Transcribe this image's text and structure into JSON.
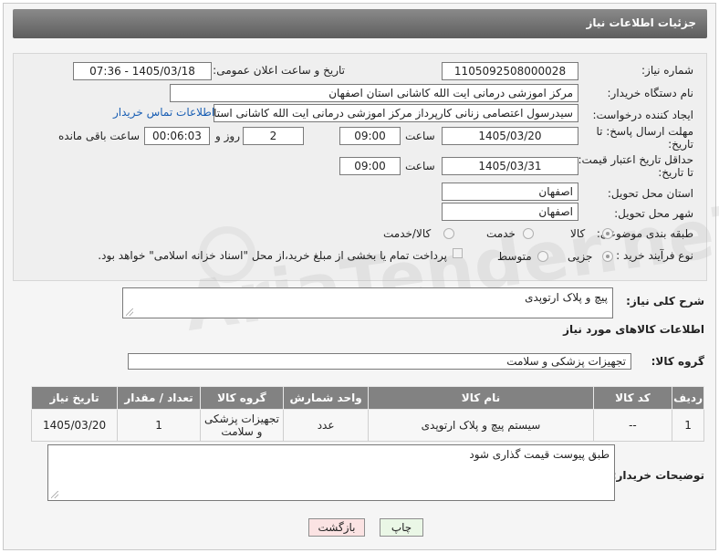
{
  "header": {
    "title": "جزئیات اطلاعات نیاز"
  },
  "fields": {
    "need_number_label": "شماره نیاز:",
    "need_number": "1105092508000028",
    "announce_label": "تاریخ و ساعت اعلان عمومی:",
    "announce_value": "1405/03/18 - 07:36",
    "buyer_org_label": "نام دستگاه خریدار:",
    "buyer_org": "مرکز اموزشی درمانی ایت الله کاشانی استان اصفهان",
    "requester_label": "ایجاد کننده درخواست:",
    "requester": "سیدرسول اعتصامی زنانی کارپرداز مرکز اموزشی درمانی ایت الله کاشانی استان اصفهان",
    "contact_link": "اطلاعات تماس خریدار",
    "deadline_label_1": "مهلت ارسال پاسخ: تا",
    "deadline_label_2": "تاریخ:",
    "deadline_date": "1405/03/20",
    "time_label": "ساعت",
    "deadline_time": "09:00",
    "days_value": "2",
    "days_label": "روز و",
    "remaining_value": "00:06:03",
    "remaining_label": "ساعت باقی مانده",
    "validity_label_1": "حداقل تاریخ اعتبار قیمت:",
    "validity_label_2": "تا تاریخ:",
    "validity_date": "1405/03/31",
    "validity_time": "09:00",
    "province_label": "استان محل تحویل:",
    "province": "اصفهان",
    "city_label": "شهر محل تحویل:",
    "city": "اصفهان",
    "category_label": "طبقه بندی موضوعی:",
    "category_options": [
      "کالا",
      "خدمت",
      "کالا/خدمت"
    ],
    "process_label": "نوع فرآیند خرید :",
    "process_options": [
      "جزیی",
      "متوسط"
    ],
    "payment_note": "پرداخت تمام یا بخشی از مبلغ خرید،از محل \"اسناد خزانه اسلامی\" خواهد بود."
  },
  "description": {
    "label": "شرح کلی نیاز:",
    "value": "پیچ و پلاک ارتوپدی"
  },
  "goods_section": {
    "title": "اطلاعات کالاهای مورد نیاز",
    "group_label": "گروه کالا:",
    "group_value": "تجهیزات پزشکی و سلامت"
  },
  "table": {
    "headers": [
      "ردیف",
      "کد کالا",
      "نام کالا",
      "واحد شمارش",
      "گروه کالا",
      "تعداد / مقدار",
      "تاریخ نیاز"
    ],
    "rows": [
      {
        "row": "1",
        "code": "--",
        "name": "سیستم پیچ و پلاک ارتوپدی",
        "unit": "عدد",
        "group": "تجهیزات پزشکی و سلامت",
        "qty": "1",
        "date": "1405/03/20"
      }
    ]
  },
  "buyer_notes": {
    "label": "توضیحات خریدار:",
    "value": "طبق پیوست قیمت گذاری شود"
  },
  "buttons": {
    "print": "چاپ",
    "back": "بازگشت"
  },
  "watermark": "AriaTender.neT"
}
